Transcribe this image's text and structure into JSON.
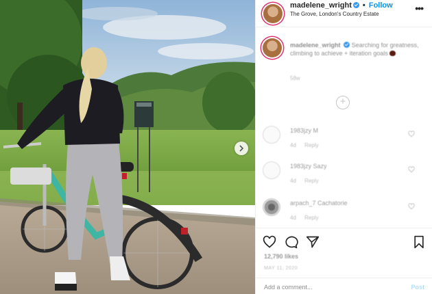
{
  "post": {
    "username": "madelene_wright",
    "separator": "•",
    "follow_label": "Follow",
    "location": "The Grove, London's Country Estate",
    "more_label": "•••"
  },
  "caption": {
    "username": "madelene_wright",
    "text": "Searching for greatness, climbing to achieve + iteration goals",
    "time": "58w"
  },
  "load_more_label": "+",
  "comments": [
    {
      "username": "1983jzy M",
      "age": "4d",
      "reply_label": "Reply"
    },
    {
      "username": "1983jzy Sazy",
      "age": "4d",
      "reply_label": "Reply"
    },
    {
      "username": "arpach_7 Cachatorie",
      "age": "4d",
      "reply_label": "Reply"
    }
  ],
  "likes": "12,790 likes",
  "date": "MAY 11, 2020",
  "add_comment": {
    "placeholder": "Add a comment...",
    "post_label": "Post"
  },
  "icons": [
    "heart-icon",
    "comment-icon",
    "share-icon",
    "bookmark-icon",
    "chevron-right-icon",
    "verified-icon",
    "more-icon"
  ],
  "colors": {
    "follow": "#0095f6",
    "verified": "#3897f0",
    "post_disabled": "#b2dffc",
    "muted": "#8e8e8e"
  }
}
